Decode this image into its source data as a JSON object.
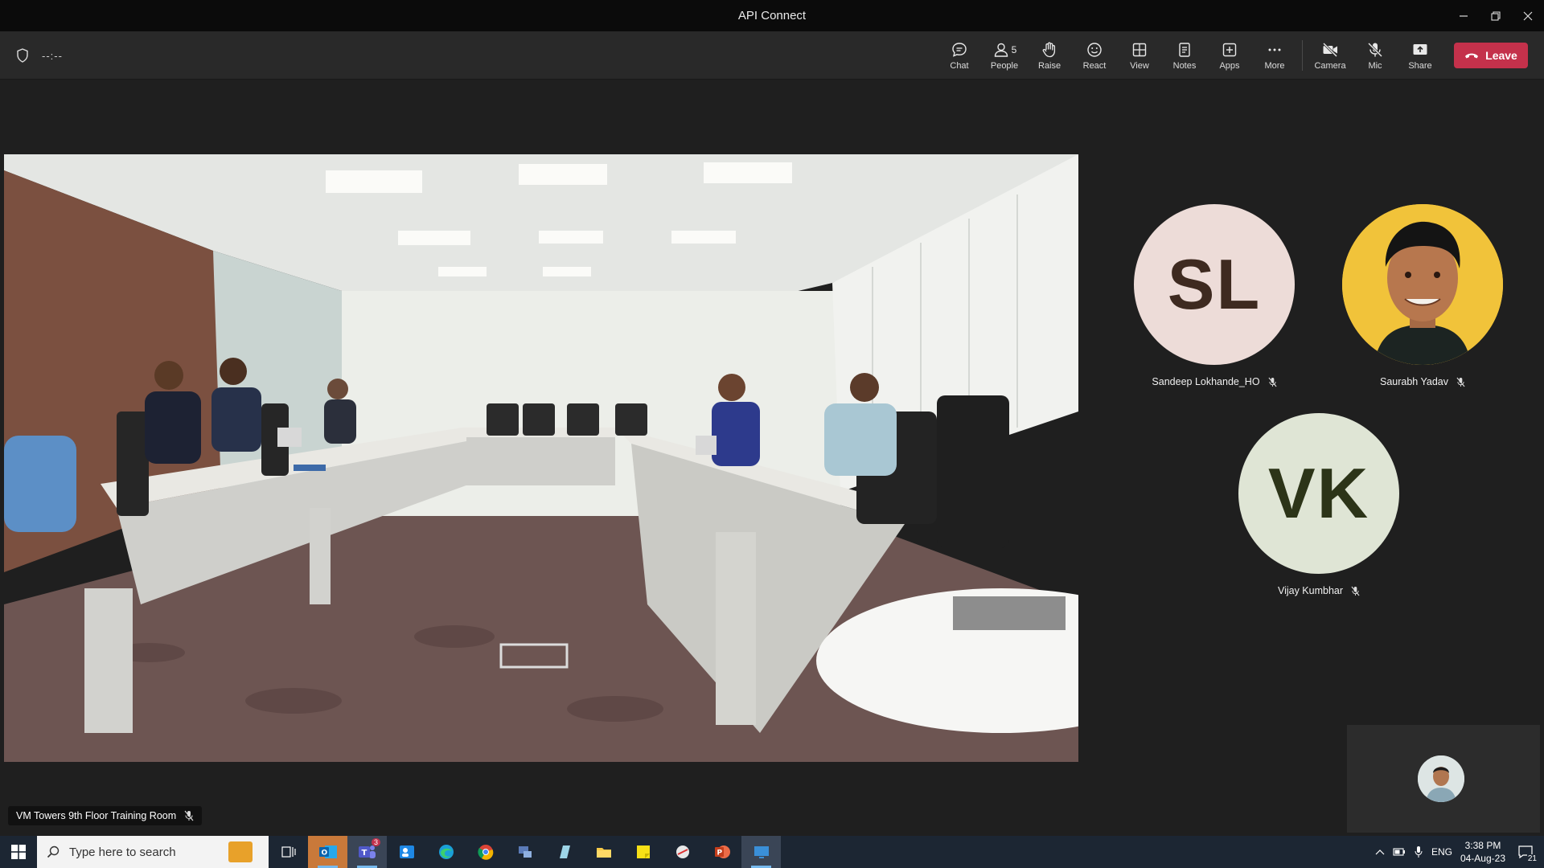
{
  "window": {
    "title": "API Connect"
  },
  "toolbar": {
    "timer": "--:--",
    "buttons": {
      "chat": "Chat",
      "people": "People",
      "people_count": "5",
      "raise": "Raise",
      "react": "React",
      "view": "View",
      "notes": "Notes",
      "apps": "Apps",
      "more": "More",
      "camera": "Camera",
      "mic": "Mic",
      "share": "Share"
    },
    "leave_label": "Leave"
  },
  "stage": {
    "room_name": "VM Towers 9th Floor Training Room"
  },
  "participants": [
    {
      "initials": "SL",
      "name": "Sandeep Lokhande_HO",
      "muted": true
    },
    {
      "initials": "",
      "name": "Saurabh Yadav",
      "muted": true
    },
    {
      "initials": "VK",
      "name": "Vijay Kumbhar",
      "muted": true
    }
  ],
  "taskbar": {
    "search_placeholder": "Type here to search",
    "teams_badge": "3",
    "language": "ENG",
    "time": "3:38 PM",
    "date": "04-Aug-23",
    "notification_count": "21"
  },
  "colors": {
    "leave": "#c4314b",
    "toolbar_bg": "#292929",
    "titlebar_bg": "#0b0b0b",
    "taskbar_bg": "#1c2633"
  }
}
